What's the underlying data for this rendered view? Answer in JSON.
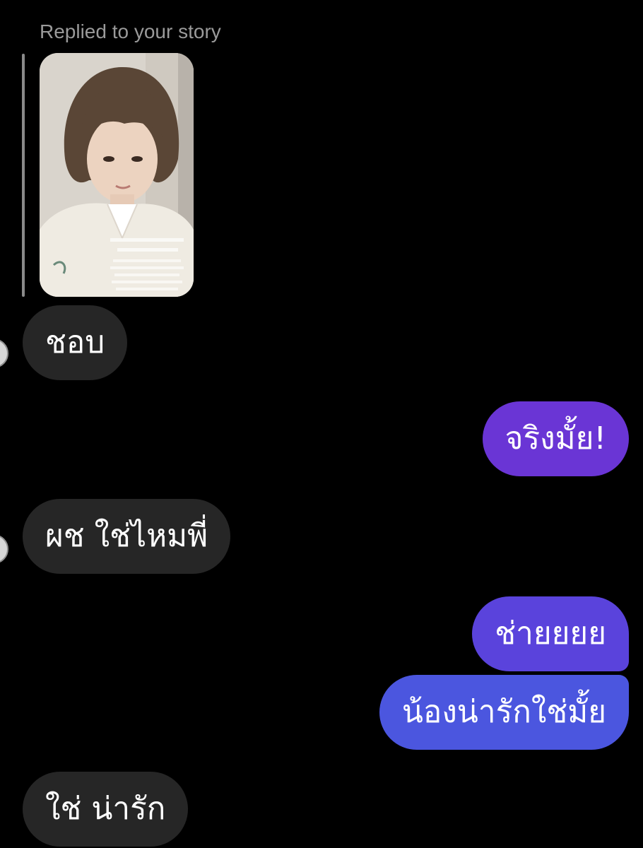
{
  "reply_header": {
    "label": "Replied to your story"
  },
  "story_preview": {
    "kind": "story-photo-thumbnail",
    "colors": {
      "background": "#d9d4cc",
      "hair": "#5a4636",
      "skin": "#ecd3c0",
      "jacket": "#efebe2"
    }
  },
  "messages": [
    {
      "direction": "received",
      "text": "ชอบ"
    },
    {
      "direction": "sent",
      "text": "จริงมั้ย!",
      "color": "#6a35d5"
    },
    {
      "direction": "received",
      "text": "ผช ใช่ไหมพี่"
    },
    {
      "direction": "sent",
      "text": "ช่ายยยย",
      "color": "#5a43dc"
    },
    {
      "direction": "sent",
      "text": "น้องน่ารักใช่มั้ย",
      "color": "#4b56df"
    },
    {
      "direction": "received",
      "text": "ใช่ น่ารัก"
    }
  ],
  "colors": {
    "background": "#000000",
    "received_bubble": "#262626",
    "text": "#ffffff",
    "reply_label": "#9a9a9a"
  }
}
